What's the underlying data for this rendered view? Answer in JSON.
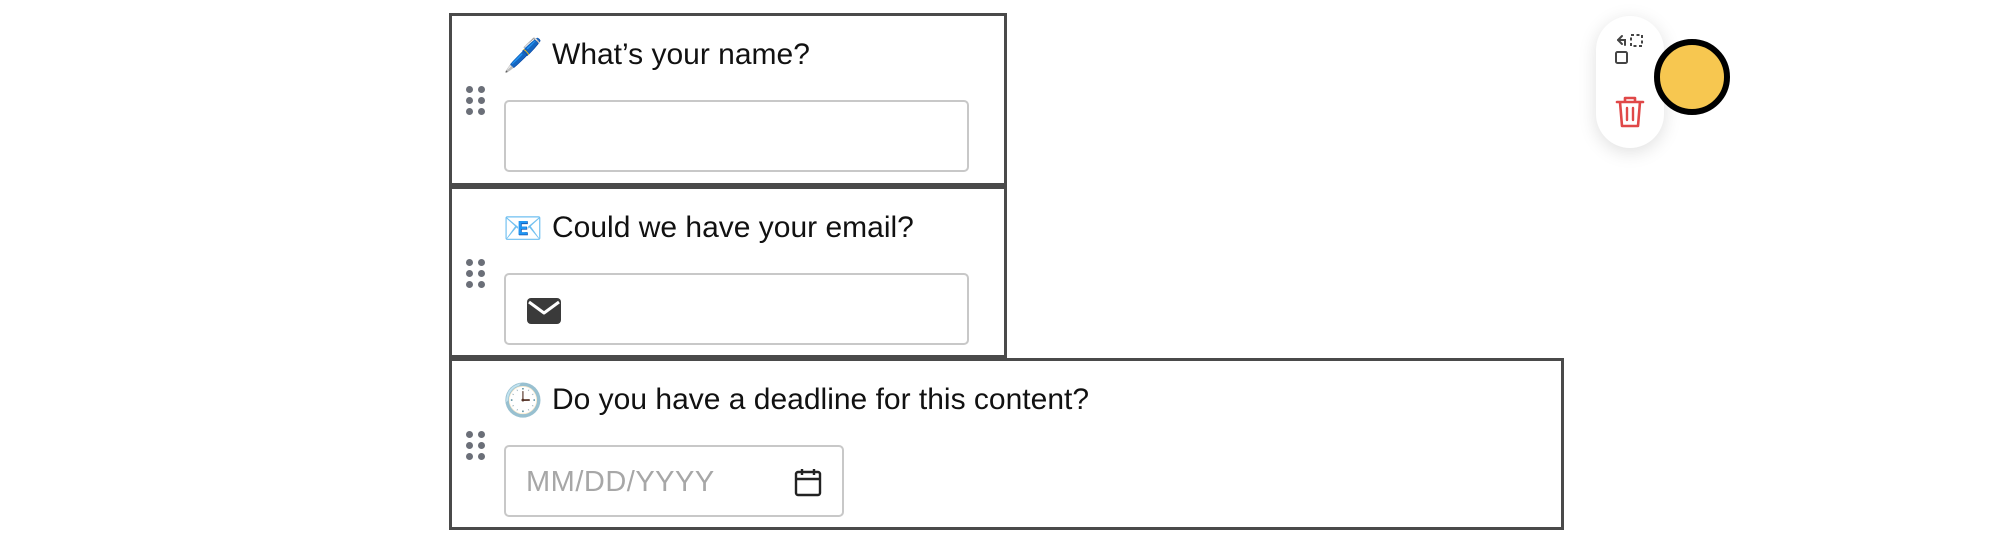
{
  "questions": [
    {
      "emoji": "🖊️",
      "emoji_icon": "pen-icon",
      "label": "What’s your name?",
      "field_type": "text",
      "value": "",
      "placeholder": ""
    },
    {
      "emoji": "📧",
      "emoji_icon": "email-envelope-icon",
      "label": "Could we have your email?",
      "field_type": "email",
      "value": "",
      "placeholder": ""
    },
    {
      "emoji": "🕒",
      "emoji_icon": "clock-icon",
      "label": "Do you have a deadline for this content?",
      "field_type": "date",
      "value": "",
      "placeholder": "MM/DD/YYYY"
    }
  ],
  "toolbar": {
    "icons": [
      "resize-icon",
      "trash-icon"
    ]
  },
  "colors": {
    "border": "#4a4a4a",
    "trash": "#e04848",
    "swatch": "#f7c750"
  }
}
